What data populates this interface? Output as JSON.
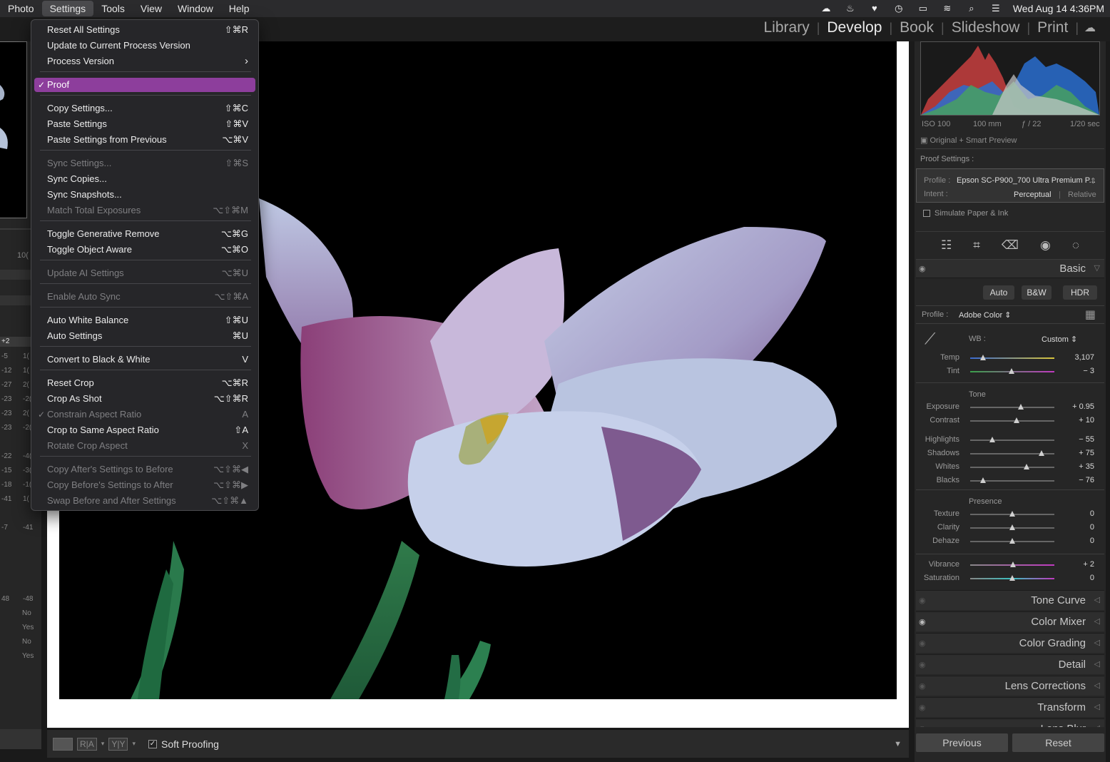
{
  "menubar": {
    "items": [
      "Photo",
      "Settings",
      "Tools",
      "View",
      "Window",
      "Help"
    ],
    "active": "Settings",
    "clock": "Wed Aug 14  4:36PM"
  },
  "modules": {
    "items": [
      "Library",
      "Develop",
      "Book",
      "Slideshow",
      "Print"
    ],
    "current": "Develop"
  },
  "menu": {
    "reset_all": {
      "label": "Reset All Settings",
      "shortcut": "⇧⌘R"
    },
    "update_pv": {
      "label": "Update to Current Process Version",
      "shortcut": ""
    },
    "process_version": {
      "label": "Process Version",
      "shortcut": "›"
    },
    "proof": {
      "label": "Proof",
      "check": "✓"
    },
    "copy_settings": {
      "label": "Copy Settings...",
      "shortcut": "⇧⌘C"
    },
    "paste_settings": {
      "label": "Paste Settings",
      "shortcut": "⇧⌘V"
    },
    "paste_prev": {
      "label": "Paste Settings from Previous",
      "shortcut": "⌥⌘V"
    },
    "sync_settings": {
      "label": "Sync Settings...",
      "shortcut": "⇧⌘S"
    },
    "sync_copies": {
      "label": "Sync Copies...",
      "shortcut": ""
    },
    "sync_snapshots": {
      "label": "Sync Snapshots...",
      "shortcut": ""
    },
    "match_exposures": {
      "label": "Match Total Exposures",
      "shortcut": "⌥⇧⌘M"
    },
    "toggle_gen_remove": {
      "label": "Toggle Generative Remove",
      "shortcut": "⌥⌘G"
    },
    "toggle_obj_aware": {
      "label": "Toggle Object Aware",
      "shortcut": "⌥⌘O"
    },
    "update_ai": {
      "label": "Update AI Settings",
      "shortcut": "⌥⌘U"
    },
    "enable_auto_sync": {
      "label": "Enable Auto Sync",
      "shortcut": "⌥⇧⌘A"
    },
    "auto_wb": {
      "label": "Auto White Balance",
      "shortcut": "⇧⌘U"
    },
    "auto_settings": {
      "label": "Auto Settings",
      "shortcut": "⌘U"
    },
    "convert_bw": {
      "label": "Convert to Black & White",
      "shortcut": "V"
    },
    "reset_crop": {
      "label": "Reset Crop",
      "shortcut": "⌥⌘R"
    },
    "crop_as_shot": {
      "label": "Crop As Shot",
      "shortcut": "⌥⇧⌘R"
    },
    "constrain_ratio": {
      "label": "Constrain Aspect Ratio",
      "shortcut": "A",
      "check": "✓"
    },
    "crop_same_ratio": {
      "label": "Crop to Same Aspect Ratio",
      "shortcut": "⇧A"
    },
    "rotate_crop": {
      "label": "Rotate Crop Aspect",
      "shortcut": "X"
    },
    "copy_after_before": {
      "label": "Copy After's Settings to Before",
      "shortcut": "⌥⇧⌘◀"
    },
    "copy_before_after": {
      "label": "Copy Before's Settings to After",
      "shortcut": "⌥⇧⌘▶"
    },
    "swap_before_after": {
      "label": "Swap Before and After Settings",
      "shortcut": "⌥⇧⌘▲"
    }
  },
  "left_panel": {
    "value_top": "10(",
    "pos2": "+2",
    "rows": [
      [
        "-5",
        "1("
      ],
      [
        "-12",
        "1("
      ],
      [
        "-27",
        "2("
      ],
      [
        "-23",
        "-2("
      ],
      [
        "-23",
        "2("
      ],
      [
        "-23",
        "-2("
      ],
      [
        "-22",
        "-4("
      ],
      [
        "-15",
        "-3("
      ],
      [
        "-18",
        "-1("
      ],
      [
        "-41",
        "1("
      ],
      [
        "-7",
        "-41"
      ],
      [
        "48",
        "-48"
      ]
    ],
    "flags": [
      "No",
      "Yes",
      "No",
      "Yes"
    ]
  },
  "toolbar": {
    "soft_proofing": "Soft Proofing",
    "view_ra": "R|A",
    "view_yy": "Y|Y"
  },
  "histogram": {
    "iso": "ISO 100",
    "focal": "100 mm",
    "aperture": "ƒ / 22",
    "shutter": "1/20 sec",
    "preview": "Original + Smart Preview"
  },
  "proof_settings": {
    "title": "Proof Settings :",
    "profile_label": "Profile :",
    "profile_value": "Epson SC-P900_700 Ultra Premium P...",
    "intent_label": "Intent :",
    "intent_perceptual": "Perceptual",
    "intent_relative": "Relative",
    "simulate": "Simulate Paper & Ink"
  },
  "basic": {
    "title": "Basic",
    "auto": "Auto",
    "bw": "B&W",
    "hdr": "HDR",
    "profile_label": "Profile :",
    "profile_value": "Adobe Color",
    "wb_label": "WB :",
    "wb_value": "Custom",
    "tone_label": "Tone",
    "presence_label": "Presence",
    "sliders": {
      "temp": {
        "label": "Temp",
        "value": "3,107",
        "pos": 0.15
      },
      "tint": {
        "label": "Tint",
        "value": "− 3",
        "pos": 0.49
      },
      "exposure": {
        "label": "Exposure",
        "value": "+ 0.95",
        "pos": 0.6
      },
      "contrast": {
        "label": "Contrast",
        "value": "+ 10",
        "pos": 0.55
      },
      "highlights": {
        "label": "Highlights",
        "value": "− 55",
        "pos": 0.26
      },
      "shadows": {
        "label": "Shadows",
        "value": "+ 75",
        "pos": 0.85
      },
      "whites": {
        "label": "Whites",
        "value": "+ 35",
        "pos": 0.67
      },
      "blacks": {
        "label": "Blacks",
        "value": "− 76",
        "pos": 0.15
      },
      "texture": {
        "label": "Texture",
        "value": "0",
        "pos": 0.5
      },
      "clarity": {
        "label": "Clarity",
        "value": "0",
        "pos": 0.5
      },
      "dehaze": {
        "label": "Dehaze",
        "value": "0",
        "pos": 0.5
      },
      "vibrance": {
        "label": "Vibrance",
        "value": "+ 2",
        "pos": 0.51
      },
      "saturation": {
        "label": "Saturation",
        "value": "0",
        "pos": 0.5
      }
    }
  },
  "panels": [
    "Tone Curve",
    "Color Mixer",
    "Color Grading",
    "Detail",
    "Lens Corrections",
    "Transform",
    "Lens Blur"
  ],
  "bottom_buttons": {
    "previous": "Previous",
    "reset": "Reset"
  },
  "colors": {
    "menu_highlight": "#8d3e9c",
    "bg": "#262626"
  }
}
